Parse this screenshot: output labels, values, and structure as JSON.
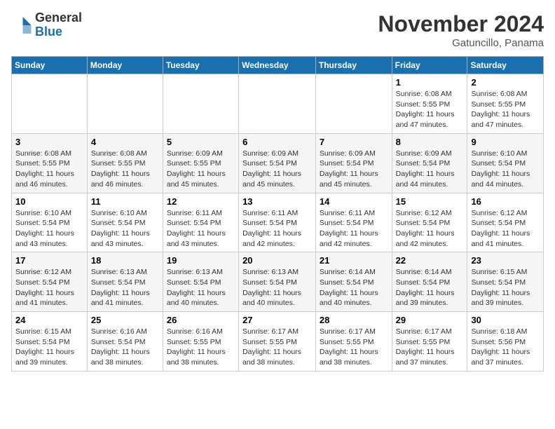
{
  "logo": {
    "general": "General",
    "blue": "Blue"
  },
  "header": {
    "month": "November 2024",
    "location": "Gatuncillo, Panama"
  },
  "weekdays": [
    "Sunday",
    "Monday",
    "Tuesday",
    "Wednesday",
    "Thursday",
    "Friday",
    "Saturday"
  ],
  "weeks": [
    [
      {
        "day": "",
        "info": ""
      },
      {
        "day": "",
        "info": ""
      },
      {
        "day": "",
        "info": ""
      },
      {
        "day": "",
        "info": ""
      },
      {
        "day": "",
        "info": ""
      },
      {
        "day": "1",
        "info": "Sunrise: 6:08 AM\nSunset: 5:55 PM\nDaylight: 11 hours and 47 minutes."
      },
      {
        "day": "2",
        "info": "Sunrise: 6:08 AM\nSunset: 5:55 PM\nDaylight: 11 hours and 47 minutes."
      }
    ],
    [
      {
        "day": "3",
        "info": "Sunrise: 6:08 AM\nSunset: 5:55 PM\nDaylight: 11 hours and 46 minutes."
      },
      {
        "day": "4",
        "info": "Sunrise: 6:08 AM\nSunset: 5:55 PM\nDaylight: 11 hours and 46 minutes."
      },
      {
        "day": "5",
        "info": "Sunrise: 6:09 AM\nSunset: 5:55 PM\nDaylight: 11 hours and 45 minutes."
      },
      {
        "day": "6",
        "info": "Sunrise: 6:09 AM\nSunset: 5:54 PM\nDaylight: 11 hours and 45 minutes."
      },
      {
        "day": "7",
        "info": "Sunrise: 6:09 AM\nSunset: 5:54 PM\nDaylight: 11 hours and 45 minutes."
      },
      {
        "day": "8",
        "info": "Sunrise: 6:09 AM\nSunset: 5:54 PM\nDaylight: 11 hours and 44 minutes."
      },
      {
        "day": "9",
        "info": "Sunrise: 6:10 AM\nSunset: 5:54 PM\nDaylight: 11 hours and 44 minutes."
      }
    ],
    [
      {
        "day": "10",
        "info": "Sunrise: 6:10 AM\nSunset: 5:54 PM\nDaylight: 11 hours and 43 minutes."
      },
      {
        "day": "11",
        "info": "Sunrise: 6:10 AM\nSunset: 5:54 PM\nDaylight: 11 hours and 43 minutes."
      },
      {
        "day": "12",
        "info": "Sunrise: 6:11 AM\nSunset: 5:54 PM\nDaylight: 11 hours and 43 minutes."
      },
      {
        "day": "13",
        "info": "Sunrise: 6:11 AM\nSunset: 5:54 PM\nDaylight: 11 hours and 42 minutes."
      },
      {
        "day": "14",
        "info": "Sunrise: 6:11 AM\nSunset: 5:54 PM\nDaylight: 11 hours and 42 minutes."
      },
      {
        "day": "15",
        "info": "Sunrise: 6:12 AM\nSunset: 5:54 PM\nDaylight: 11 hours and 42 minutes."
      },
      {
        "day": "16",
        "info": "Sunrise: 6:12 AM\nSunset: 5:54 PM\nDaylight: 11 hours and 41 minutes."
      }
    ],
    [
      {
        "day": "17",
        "info": "Sunrise: 6:12 AM\nSunset: 5:54 PM\nDaylight: 11 hours and 41 minutes."
      },
      {
        "day": "18",
        "info": "Sunrise: 6:13 AM\nSunset: 5:54 PM\nDaylight: 11 hours and 41 minutes."
      },
      {
        "day": "19",
        "info": "Sunrise: 6:13 AM\nSunset: 5:54 PM\nDaylight: 11 hours and 40 minutes."
      },
      {
        "day": "20",
        "info": "Sunrise: 6:13 AM\nSunset: 5:54 PM\nDaylight: 11 hours and 40 minutes."
      },
      {
        "day": "21",
        "info": "Sunrise: 6:14 AM\nSunset: 5:54 PM\nDaylight: 11 hours and 40 minutes."
      },
      {
        "day": "22",
        "info": "Sunrise: 6:14 AM\nSunset: 5:54 PM\nDaylight: 11 hours and 39 minutes."
      },
      {
        "day": "23",
        "info": "Sunrise: 6:15 AM\nSunset: 5:54 PM\nDaylight: 11 hours and 39 minutes."
      }
    ],
    [
      {
        "day": "24",
        "info": "Sunrise: 6:15 AM\nSunset: 5:54 PM\nDaylight: 11 hours and 39 minutes."
      },
      {
        "day": "25",
        "info": "Sunrise: 6:16 AM\nSunset: 5:54 PM\nDaylight: 11 hours and 38 minutes."
      },
      {
        "day": "26",
        "info": "Sunrise: 6:16 AM\nSunset: 5:55 PM\nDaylight: 11 hours and 38 minutes."
      },
      {
        "day": "27",
        "info": "Sunrise: 6:17 AM\nSunset: 5:55 PM\nDaylight: 11 hours and 38 minutes."
      },
      {
        "day": "28",
        "info": "Sunrise: 6:17 AM\nSunset: 5:55 PM\nDaylight: 11 hours and 38 minutes."
      },
      {
        "day": "29",
        "info": "Sunrise: 6:17 AM\nSunset: 5:55 PM\nDaylight: 11 hours and 37 minutes."
      },
      {
        "day": "30",
        "info": "Sunrise: 6:18 AM\nSunset: 5:56 PM\nDaylight: 11 hours and 37 minutes."
      }
    ]
  ]
}
